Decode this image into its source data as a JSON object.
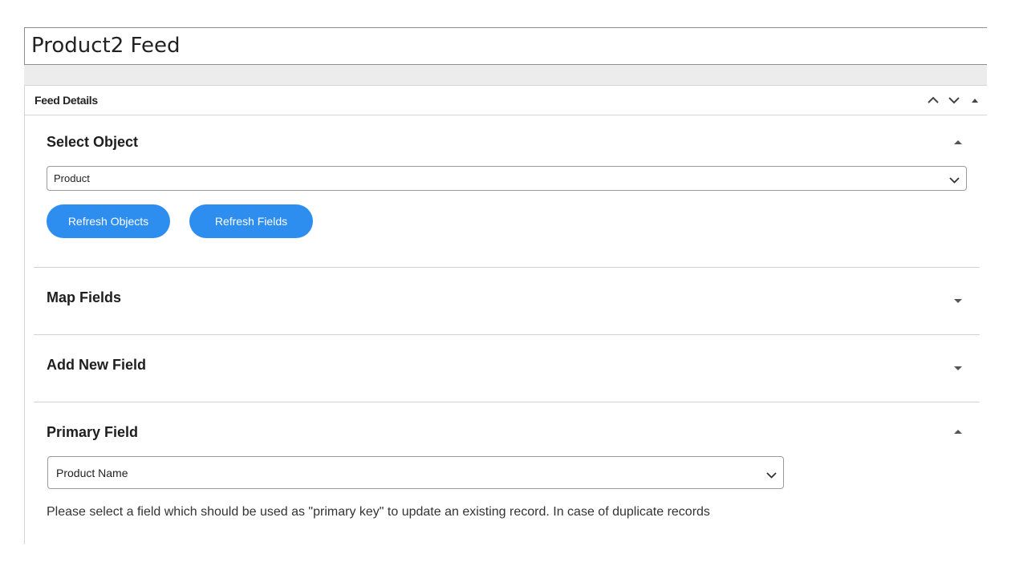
{
  "page": {
    "title": "Product2 Feed"
  },
  "feed_details": {
    "title": "Feed Details",
    "controls": [
      "chevron-up-icon",
      "chevron-down-icon",
      "caret-up-icon"
    ]
  },
  "select_object": {
    "title": "Select Object",
    "select_value": "Product",
    "buttons": {
      "refresh_objects": "Refresh Objects",
      "refresh_fields": "Refresh Fields"
    }
  },
  "map_fields": {
    "title": "Map Fields"
  },
  "add_new_field": {
    "title": "Add New Field"
  },
  "primary_field": {
    "title": "Primary Field",
    "select_value": "Product Name",
    "help_text": "Please select a field which should be used as \"primary key\" to update an existing record. In case of duplicate records"
  },
  "colors": {
    "accent": "#2e8ef0",
    "border": "#d3d3d3",
    "title_text": "#1e1e1e"
  }
}
